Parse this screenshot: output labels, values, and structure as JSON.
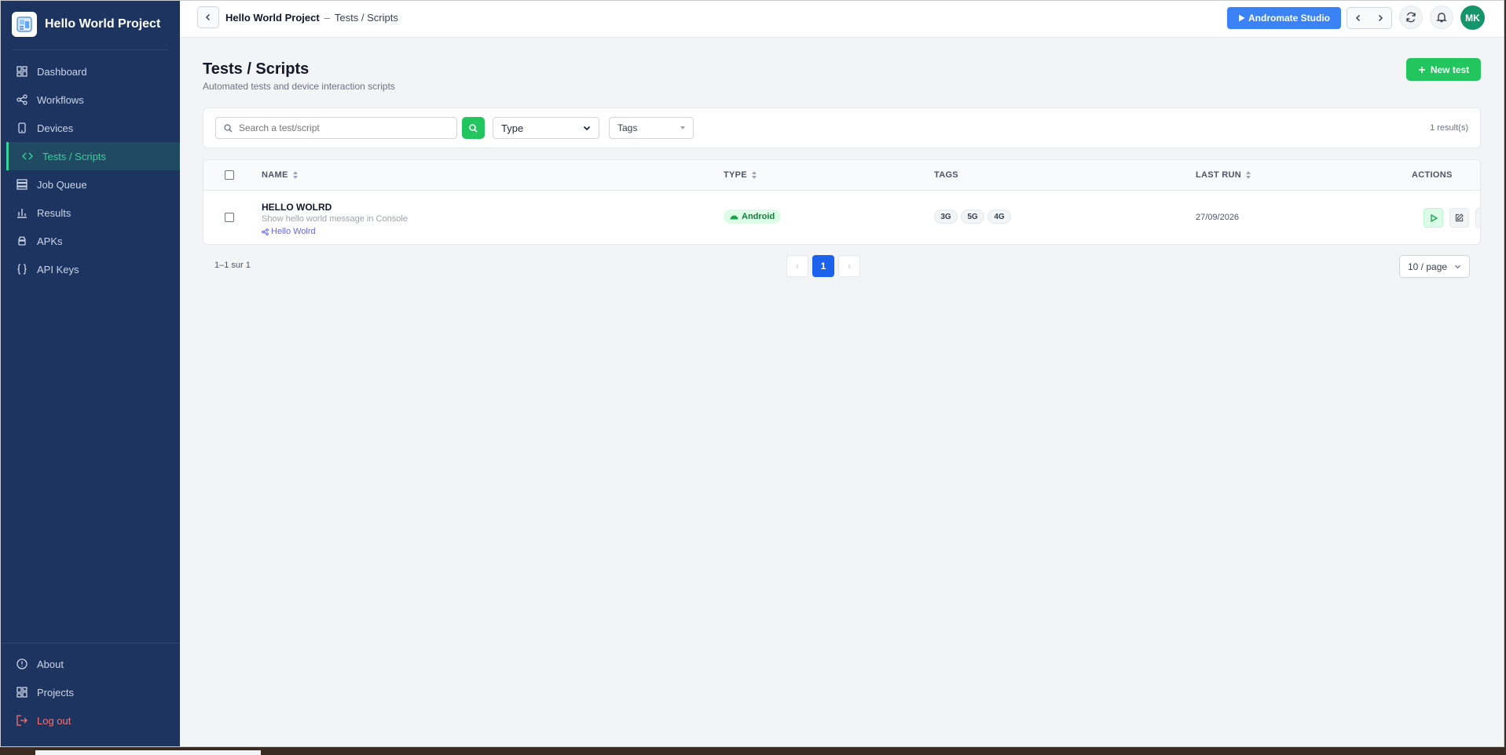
{
  "app": {
    "project_name": "Hello World Project"
  },
  "sidebar": {
    "items": [
      {
        "label": "Dashboard",
        "icon": "dashboard-icon"
      },
      {
        "label": "Workflows",
        "icon": "share-nodes-icon"
      },
      {
        "label": "Devices",
        "icon": "mobile-device-icon"
      },
      {
        "label": "Tests / Scripts",
        "icon": "code-brackets-icon",
        "active": true
      },
      {
        "label": "Job Queue",
        "icon": "stack-icon"
      },
      {
        "label": "Results",
        "icon": "bar-chart-icon"
      },
      {
        "label": "APKs",
        "icon": "android-icon"
      },
      {
        "label": "API Keys",
        "icon": "curly-braces-icon"
      }
    ],
    "bottom_items": [
      {
        "label": "About",
        "icon": "info-circle-icon"
      },
      {
        "label": "Projects",
        "icon": "grid-icon"
      },
      {
        "label": "Log out",
        "icon": "logout-icon"
      }
    ]
  },
  "header": {
    "breadcrumb_project": "Hello World Project",
    "breadcrumb_separator": "–",
    "breadcrumb_current": "Tests / Scripts",
    "studio_button": "Andromate Studio",
    "avatar_initials": "MK"
  },
  "page": {
    "title": "Tests / Scripts",
    "subtitle": "Automated tests and device interaction scripts",
    "new_button": "New test"
  },
  "filters": {
    "search_placeholder": "Search a test/script",
    "search_value": "",
    "type_value": "Type",
    "tags_value": "Tags",
    "result_count": "1 result(s)"
  },
  "table": {
    "columns": {
      "name": "NAME",
      "type": "TYPE",
      "tags": "TAGS",
      "last_run": "LAST RUN",
      "actions": "ACTIONS"
    },
    "rows": [
      {
        "name": "HELLO WOLRD",
        "description": "Show hello world message in Console",
        "workflow": "Hello Wolrd",
        "type": "Android",
        "tags": [
          "3G",
          "5G",
          "4G"
        ],
        "last_run": "27/09/2026"
      }
    ]
  },
  "pagination": {
    "summary": "1–1 sur 1",
    "prev": "‹",
    "current_page": "1",
    "next": "›",
    "page_size": "10 / page"
  },
  "colors": {
    "sidebar_bg": "#1d3461",
    "active_accent": "#34d399",
    "primary_green": "#22c55e",
    "studio_blue": "#3b82f6",
    "page_blue": "#1d62ec",
    "logout_red": "#f87171"
  }
}
